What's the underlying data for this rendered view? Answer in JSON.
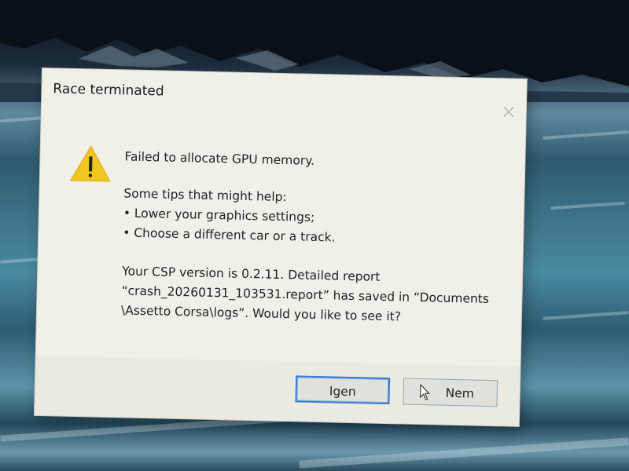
{
  "dialog": {
    "title": "Race terminated",
    "message_heading": "Failed to allocate GPU memory.",
    "tips_intro": "Some tips that might help:",
    "tips": [
      "• Lower your graphics settings;",
      "• Choose a different car or a track."
    ],
    "report_lines": [
      "Your CSP version is 0.2.11. Detailed report",
      "“crash_20260131_103531.report” has saved in “Documents",
      "\\Assetto Corsa\\logs”. Would you like to see it?"
    ],
    "buttons": {
      "yes_label": "Igen",
      "no_label": "Nem"
    },
    "icons": {
      "warning": "warning-triangle-icon",
      "close": "close-icon",
      "cursor": "mouse-pointer-icon"
    },
    "colors": {
      "warning_fill": "#f2c521",
      "focus_border": "#3a7bc9"
    }
  }
}
